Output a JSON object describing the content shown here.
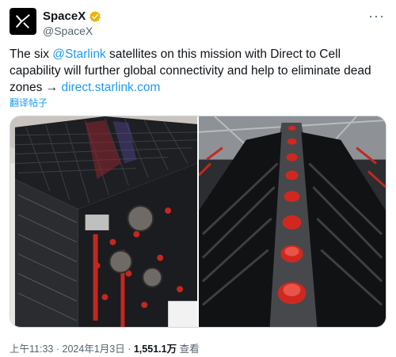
{
  "tweet": {
    "author_name": "SpaceX",
    "author_handle": "@SpaceX",
    "text_before": "The six ",
    "mention": "@Starlink",
    "text_after": " satellites on this mission with Direct to Cell capability will further global connectivity and help to eliminate dead zones → ",
    "link": "direct.starlink.com",
    "translate_label": "翻译帖子",
    "more_label": "···",
    "time": "上午11:33",
    "date": "2024年1月3日",
    "views_count": "1,551.1万",
    "views_label": "查看",
    "separator": "·"
  },
  "media": {
    "image_left": "starlink-satellite-stack-photo",
    "image_right": "satellite-dispenser-red-caps-photo"
  },
  "colors": {
    "link": "#1d9bf0",
    "verified": "#e8b60a",
    "secondary_text": "#536471"
  }
}
